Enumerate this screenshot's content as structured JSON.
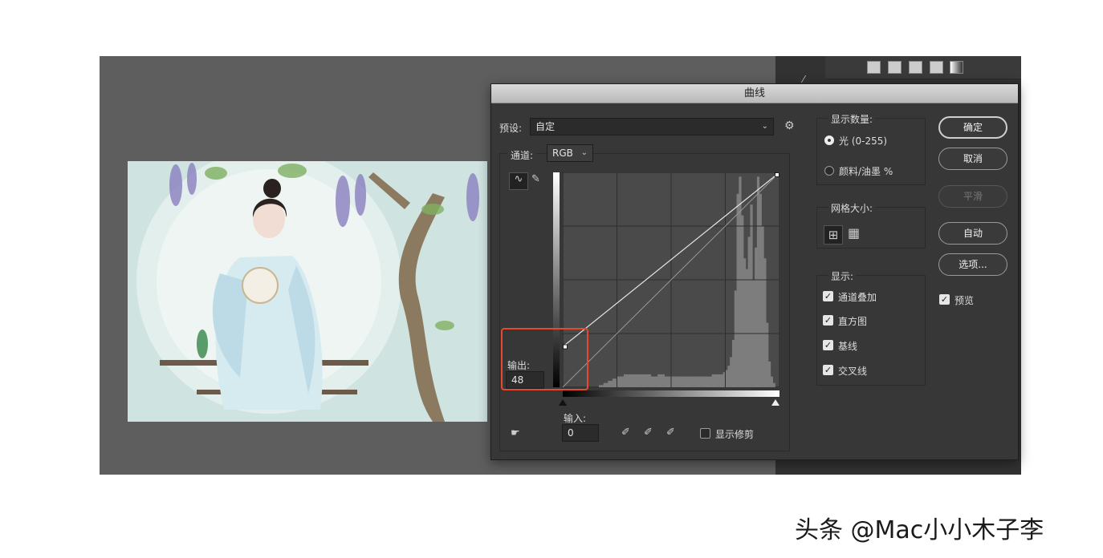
{
  "dialog": {
    "title": "曲线",
    "preset_label": "预设:",
    "preset_value": "自定",
    "channel_label": "通道:",
    "channel_value": "RGB",
    "output_label": "输出:",
    "output_value": "48",
    "input_label": "输入:",
    "input_value": "0",
    "show_clipping_label": "显示修剪"
  },
  "display_amount": {
    "title": "显示数量:",
    "options": [
      {
        "label": "光 (0-255)",
        "selected": true
      },
      {
        "label": "颜料/油墨 %",
        "selected": false
      }
    ]
  },
  "grid_size": {
    "title": "网格大小:"
  },
  "show": {
    "title": "显示:",
    "options": [
      {
        "label": "通道叠加",
        "checked": true
      },
      {
        "label": "直方图",
        "checked": true
      },
      {
        "label": "基线",
        "checked": true
      },
      {
        "label": "交叉线",
        "checked": true
      }
    ]
  },
  "buttons": {
    "ok": "确定",
    "cancel": "取消",
    "smooth": "平滑",
    "auto": "自动",
    "options": "选项..."
  },
  "preview": {
    "label": "预览",
    "checked": true
  },
  "curve": {
    "points": [
      [
        0,
        48
      ],
      [
        255,
        255
      ]
    ],
    "baseline": [
      [
        0,
        0
      ],
      [
        255,
        255
      ]
    ],
    "histogram": [
      0,
      0,
      0,
      0,
      0,
      0,
      0,
      0,
      0,
      0,
      0,
      0,
      0,
      0,
      0,
      0,
      0.01,
      0.01,
      0.02,
      0.02,
      0.03,
      0.03,
      0.04,
      0.04,
      0.05,
      0.05,
      0.05,
      0.06,
      0.06,
      0.06,
      0.06,
      0.06,
      0.06,
      0.06,
      0.06,
      0.06,
      0.06,
      0.06,
      0.06,
      0.05,
      0.05,
      0.05,
      0.06,
      0.06,
      0.06,
      0.05,
      0.05,
      0.05,
      0.05,
      0.05,
      0.05,
      0.05,
      0.05,
      0.05,
      0.05,
      0.05,
      0.05,
      0.05,
      0.05,
      0.05,
      0.05,
      0.05,
      0.05,
      0.05,
      0.05,
      0.05,
      0.06,
      0.06,
      0.06,
      0.06,
      0.06,
      0.07,
      0.08,
      0.1,
      0.14,
      0.22,
      0.45,
      0.9,
      0.98,
      0.8,
      0.6,
      0.55,
      0.7,
      0.85,
      0.5,
      0.65,
      0.98,
      0.9,
      0.75,
      0.6,
      0.3,
      0.12,
      0.05,
      0.02,
      0,
      0
    ]
  },
  "colors": {
    "dialog_bg": "#373737",
    "workspace_bg": "#5e5e5e",
    "highlight": "#e8492d"
  },
  "watermark": "头条 @Mac小小木子李",
  "icons": [
    "curve-point-icon",
    "pencil-icon",
    "gear-icon",
    "grid-small-icon",
    "grid-large-icon",
    "eyedropper-black-icon",
    "eyedropper-gray-icon",
    "eyedropper-white-icon",
    "on-image-adjust-icon"
  ]
}
